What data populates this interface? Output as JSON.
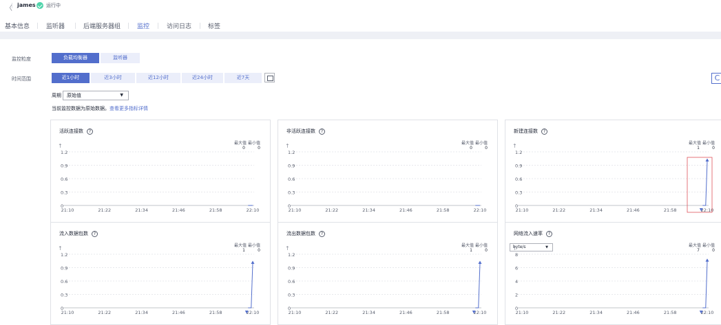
{
  "header": {
    "back": "〈",
    "name": "james",
    "status": "运行中"
  },
  "tabs": [
    "基本信息",
    "监听器",
    "后端服务器组",
    "监控",
    "访问日志",
    "标签"
  ],
  "active_tab": 3,
  "filters": {
    "granularity_label": "监控粒度",
    "granularity_options": [
      "负载均衡器",
      "监听器"
    ],
    "granularity_selected": 0,
    "time_label": "时间范围",
    "time_options": [
      "近1小时",
      "近3小时",
      "近12小时",
      "近24小时",
      "近7天"
    ],
    "time_selected": 0,
    "period_label": "周期",
    "period_value": "原始值",
    "notice_text": "当前监控数据为原始数据。",
    "notice_link": "查看更多指标详情"
  },
  "legend": {
    "max_label": "最大值",
    "min_label": "最小值"
  },
  "accent": "#526ecc",
  "chart_data": [
    {
      "type": "line",
      "title": "活跃连接数",
      "max": "0",
      "min": "0",
      "x": [
        "21:10",
        "21:22",
        "21:34",
        "21:46",
        "21:58",
        "22:10"
      ],
      "yticks": [
        "0",
        "0.3",
        "0.6",
        "0.9",
        "1.2"
      ],
      "ylim": [
        0,
        1.2
      ],
      "points": [
        [
          58.5,
          0
        ],
        [
          60,
          0
        ]
      ]
    },
    {
      "type": "line",
      "title": "非活跃连接数",
      "max": "0",
      "min": "0",
      "x": [
        "21:10",
        "21:22",
        "21:34",
        "21:46",
        "21:58",
        "22:10"
      ],
      "yticks": [
        "0",
        "0.3",
        "0.6",
        "0.9",
        "1.2"
      ],
      "ylim": [
        0,
        1.2
      ],
      "points": [
        [
          58.5,
          0
        ],
        [
          60,
          0
        ]
      ]
    },
    {
      "type": "line",
      "title": "新建连接数",
      "max": "1",
      "min": "0",
      "x": [
        "21:10",
        "21:22",
        "21:34",
        "21:46",
        "21:58",
        "22:10"
      ],
      "yticks": [
        "0",
        "0.3",
        "0.6",
        "0.9",
        "1.2"
      ],
      "ylim": [
        0,
        1.2
      ],
      "points": [
        [
          58.5,
          0
        ],
        [
          59.5,
          0
        ],
        [
          60,
          1
        ]
      ],
      "highlight": true
    },
    {
      "type": "line",
      "title": "流入数据包数",
      "max": "1",
      "min": "0",
      "x": [
        "21:10",
        "21:22",
        "21:34",
        "21:46",
        "21:58",
        "22:10"
      ],
      "yticks": [
        "0",
        "0.3",
        "0.6",
        "0.9",
        "1.2"
      ],
      "ylim": [
        0,
        1.2
      ],
      "points": [
        [
          58.5,
          0
        ],
        [
          59.5,
          0
        ],
        [
          60,
          1
        ]
      ]
    },
    {
      "type": "line",
      "title": "流出数据包数",
      "max": "1",
      "min": "0",
      "x": [
        "21:10",
        "21:22",
        "21:34",
        "21:46",
        "21:58",
        "22:10"
      ],
      "yticks": [
        "0",
        "0.3",
        "0.6",
        "0.9",
        "1.2"
      ],
      "ylim": [
        0,
        1.2
      ],
      "points": [
        [
          58.5,
          0
        ],
        [
          59.5,
          0
        ],
        [
          60,
          1
        ]
      ]
    },
    {
      "type": "line",
      "title": "网络流入速率",
      "unit": "byte/s",
      "max": "7",
      "min": "0",
      "x": [
        "21:10",
        "21:22",
        "21:34",
        "21:46",
        "21:58",
        "22:10"
      ],
      "yticks": [
        "0",
        "2",
        "4",
        "6",
        "8"
      ],
      "ylim": [
        0,
        8
      ],
      "points": [
        [
          58.5,
          0
        ],
        [
          59.5,
          0
        ],
        [
          60,
          7
        ]
      ]
    }
  ]
}
